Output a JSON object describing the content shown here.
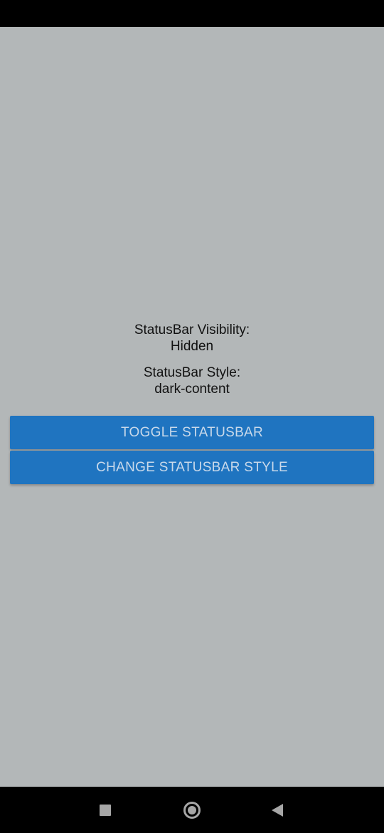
{
  "status": {
    "visibility_label": "StatusBar Visibility:",
    "visibility_value": "Hidden",
    "style_label": "StatusBar Style:",
    "style_value": "dark-content"
  },
  "buttons": {
    "toggle_label": "TOGGLE STATUSBAR",
    "change_style_label": "CHANGE STATUSBAR STYLE"
  },
  "navigation": {
    "items": [
      {
        "icon": "recents-icon"
      },
      {
        "icon": "home-icon"
      },
      {
        "icon": "back-icon"
      }
    ]
  },
  "colors": {
    "background": "#b3b7b8",
    "button": "#1f74c0",
    "button_text": "#c9d9ea",
    "system_bar": "#000000"
  }
}
